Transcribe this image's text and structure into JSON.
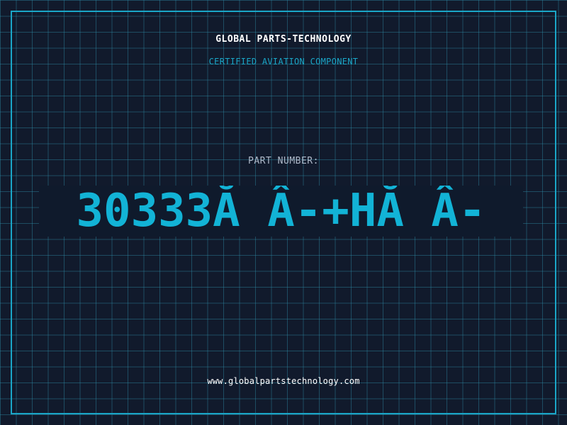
{
  "header": {
    "title": "GLOBAL PARTS-TECHNOLOGY",
    "subtitle": "CERTIFIED AVIATION COMPONENT"
  },
  "part": {
    "label": "PART NUMBER:",
    "number": "30333Ă Â-+HĂ Â-"
  },
  "footer": {
    "url": "www.globalpartstechnology.com"
  },
  "colors": {
    "background": "#111a2c",
    "accent": "#1aa6c7",
    "part_number": "#12b3d6",
    "label": "#aeb8c8",
    "text_primary": "#ffffff"
  }
}
